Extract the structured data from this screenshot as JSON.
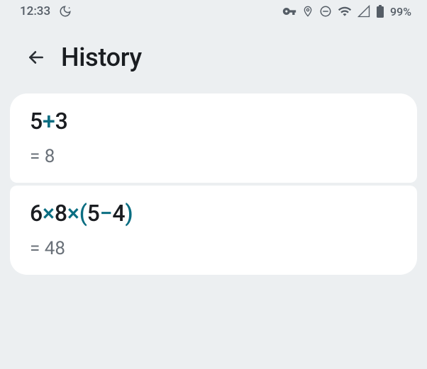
{
  "status": {
    "time": "12:33",
    "battery": "99%"
  },
  "header": {
    "title": "History"
  },
  "history": [
    {
      "expression": "5+3",
      "result": "= 8"
    },
    {
      "expression": "6×8×(5−4)",
      "result": "= 48"
    }
  ],
  "operator_color": "#0b6e82"
}
